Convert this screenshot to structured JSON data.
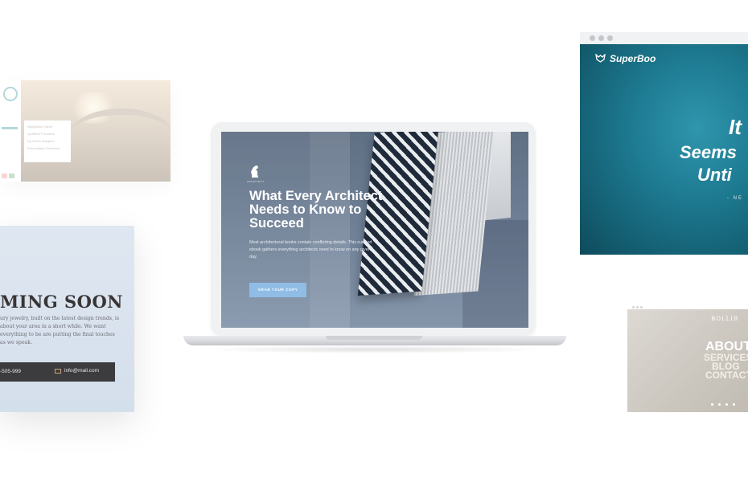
{
  "colors": {
    "laptop_frame": "#f0f1f3",
    "cta_button": "#8fbde6",
    "superboo_teal": "#1d7a91",
    "coming_soon_bar": "#3c3c3e"
  },
  "arch_card": {
    "menu_items": [
      "Navigation Cards",
      "Qualified Providers",
      "Up Hours Mappers",
      "Presentation Platforms"
    ]
  },
  "coming_soon_card": {
    "title": "MING SOON",
    "text": "ury jewelry, built on the latest design trends, is about your area in a short while. We want everything to be are putting the final touches as we speak.",
    "phone": "-505-999",
    "email": "info@mail.com",
    "mail_icon": "mail-icon"
  },
  "laptop_site": {
    "logo_text": "ARCHITECT",
    "heading": "What Every Architect Needs to Know to Succeed",
    "body": "Most architectural books contain conflicting details. This curated ebook gathers everything architects need to know on any given day.",
    "cta_label": "GRAB YOUR COPY"
  },
  "superboo_card": {
    "logo": "SuperBoo",
    "logo_icon": "fox-icon",
    "line1": "It",
    "line2": "Seems",
    "line3": "Unti",
    "small": "- NE"
  },
  "lion_card": {
    "brand": "BOLLIR",
    "menu": [
      "ABOUT",
      "SERVICES",
      "BLOG",
      "CONTACT"
    ]
  }
}
